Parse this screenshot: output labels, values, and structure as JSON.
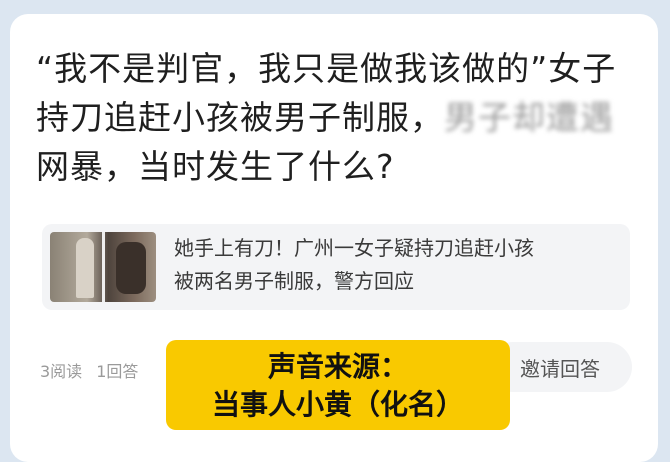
{
  "question": {
    "title_main": "“我不是判官，我只是做我该做的”女子持刀追赶小孩被男子制服，",
    "title_blurred": "男子却遭遇",
    "title_end": "网暴，当时发生了什么?"
  },
  "linked_article": {
    "text_line1": "她手上有刀！广州一女子疑持刀追赶小孩",
    "text_line2": "被两名男子制服，警方回应"
  },
  "meta": {
    "reads": "3阅读",
    "answers": "1回答"
  },
  "actions": {
    "invite_label": "邀请回答"
  },
  "subtitle": {
    "line1": "声音来源：",
    "line2": "当事人小黄（化名）"
  },
  "colors": {
    "page_bg": "#dce6f1",
    "card_bg": "#ffffff",
    "subtitle_bg": "#f9c900"
  }
}
